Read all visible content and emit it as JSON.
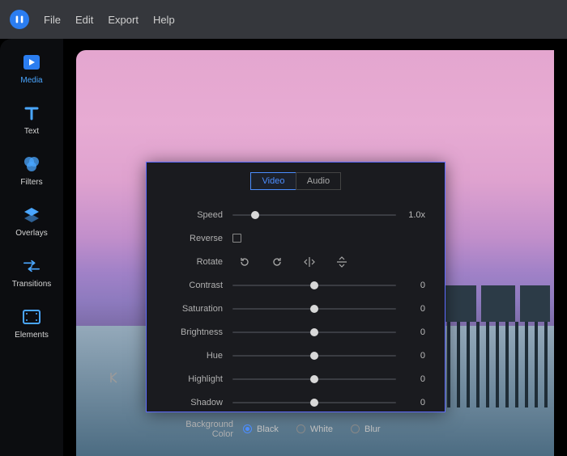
{
  "menubar": {
    "items": [
      "File",
      "Edit",
      "Export",
      "Help"
    ]
  },
  "sidebar": {
    "items": [
      {
        "label": "Media",
        "icon": "media-icon",
        "active": true
      },
      {
        "label": "Text",
        "icon": "text-icon",
        "active": false
      },
      {
        "label": "Filters",
        "icon": "filters-icon",
        "active": false
      },
      {
        "label": "Overlays",
        "icon": "overlays-icon",
        "active": false
      },
      {
        "label": "Transitions",
        "icon": "transitions-icon",
        "active": false
      },
      {
        "label": "Elements",
        "icon": "elements-icon",
        "active": false
      }
    ]
  },
  "panel": {
    "tabs": {
      "video": "Video",
      "audio": "Audio",
      "active": "video"
    },
    "speed": {
      "label": "Speed",
      "value": "1.0x",
      "pos": 14
    },
    "reverse": {
      "label": "Reverse",
      "checked": false
    },
    "rotate": {
      "label": "Rotate"
    },
    "contrast": {
      "label": "Contrast",
      "value": "0",
      "pos": 50
    },
    "saturation": {
      "label": "Saturation",
      "value": "0",
      "pos": 50
    },
    "brightness": {
      "label": "Brightness",
      "value": "0",
      "pos": 50
    },
    "hue": {
      "label": "Hue",
      "value": "0",
      "pos": 50
    },
    "highlight": {
      "label": "Highlight",
      "value": "0",
      "pos": 50
    },
    "shadow": {
      "label": "Shadow",
      "value": "0",
      "pos": 50
    },
    "bg_color": {
      "label": "Background Color",
      "options": {
        "black": "Black",
        "white": "White",
        "blur": "Blur"
      },
      "selected": "black"
    }
  },
  "colors": {
    "accent": "#4c8dff",
    "panel_border": "#5e6cff"
  }
}
